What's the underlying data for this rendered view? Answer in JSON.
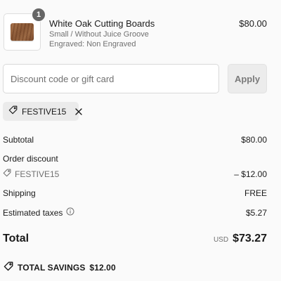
{
  "product": {
    "quantity": "1",
    "title": "White Oak Cutting Boards",
    "variant": "Small / Without Juice Groove",
    "engraving": "Engraved: Non Engraved",
    "price": "$80.00"
  },
  "discount": {
    "placeholder": "Discount code or gift card",
    "value": "",
    "apply_label": "Apply"
  },
  "applied_code": {
    "label": "FESTIVE15"
  },
  "summary": {
    "subtotal_label": "Subtotal",
    "subtotal_value": "$80.00",
    "order_discount_label": "Order discount",
    "discount_code": "FESTIVE15",
    "discount_value": "– $12.00",
    "shipping_label": "Shipping",
    "shipping_value": "FREE",
    "taxes_label": "Estimated taxes",
    "taxes_value": "$5.27",
    "total_label": "Total",
    "currency": "USD",
    "total_value": "$73.27",
    "savings_label": "TOTAL SAVINGS",
    "savings_value": "$12.00"
  },
  "icons": {
    "tag": "tag-icon",
    "close": "close-icon",
    "info": "info-icon",
    "savings": "savings-tag-icon"
  },
  "colors": {
    "muted_text": "#707070",
    "badge_bg": "#666666",
    "chip_bg": "#ebebeb"
  }
}
